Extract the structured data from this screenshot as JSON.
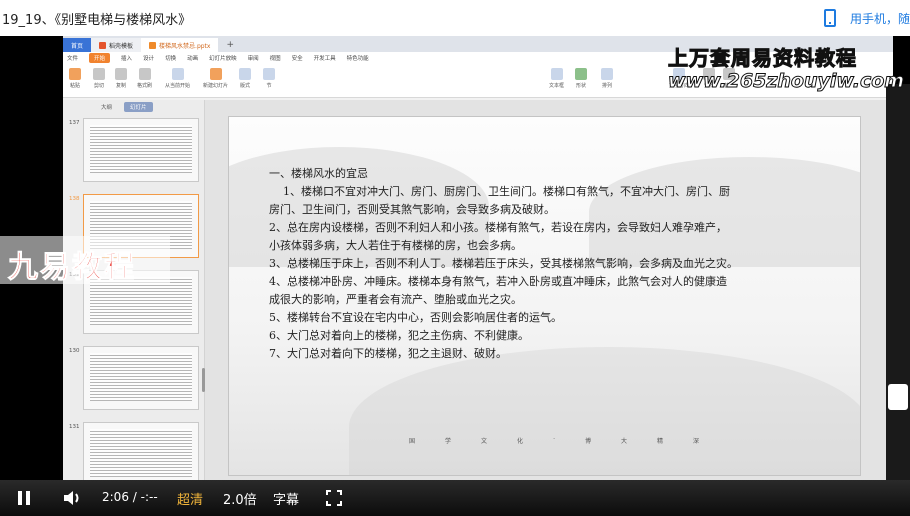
{
  "page_title": "19_19、《别墅电梯与楼梯风水》",
  "phone_link": "用手机，随",
  "wps": {
    "tabs": [
      "首页",
      "稻壳模板",
      "楼梯风水禁忌.pptx"
    ],
    "menu": [
      "文件",
      "开始",
      "插入",
      "设计",
      "切换",
      "动画",
      "幻灯片放映",
      "审阅",
      "视图",
      "安全",
      "开发工具",
      "特色功能"
    ],
    "active_menu": "开始",
    "ribbon": [
      "粘贴",
      "剪切",
      "复制",
      "格式刷",
      "从当前开始",
      "新建幻灯片",
      "版式",
      "节",
      "文本框",
      "形状",
      "排列",
      "文字方向",
      "查找",
      "替换"
    ],
    "panel_tabs": [
      "大纲",
      "幻灯片"
    ],
    "thumb_numbers": [
      "137",
      "138",
      "139",
      "130",
      "131"
    ]
  },
  "slide": {
    "heading": "一、楼梯风水的宜忌",
    "lines": [
      "1、楼梯口不宜对冲大门、房门、厨房门、卫生间门。楼梯口有煞气，不宜冲大门、房门、厨",
      "房门、卫生间门，否则受其煞气影响，会导致多病及破财。",
      "2、总在房内设楼梯，否则不利妇人和小孩。楼梯有煞气，若设在房内，会导致妇人难孕难产，",
      "小孩体弱多病，大人若住于有楼梯的房，也会多病。",
      "3、总楼梯压于床上，否则不利人丁。楼梯若压于床头，受其楼梯煞气影响，会多病及血光之灾。",
      "4、总楼梯冲卧房、冲睡床。楼梯本身有煞气，若冲入卧房或直冲睡床，此煞气会对人的健康造",
      "成很大的影响，严重者会有流产、堕胎或血光之灾。",
      "5、楼梯转台不宜设在宅内中心，否则会影响居住者的运气。",
      "6、大门总对着向上的楼梯，犯之主伤病、不利健康。",
      "7、大门总对着向下的楼梯，犯之主退财、破财。"
    ],
    "footer": [
      "国",
      "学",
      "文",
      "化",
      "·",
      "博",
      "大",
      "精",
      "深"
    ]
  },
  "watermarks": {
    "top": "上万套周易资料教程",
    "url": "www.265zhouyiw.com",
    "brand": "九易教程"
  },
  "player": {
    "time_current": "2:06",
    "time_separator": "/",
    "time_total": "-:--",
    "quality": "超清",
    "speed": "2.0倍",
    "subtitle": "字幕"
  }
}
